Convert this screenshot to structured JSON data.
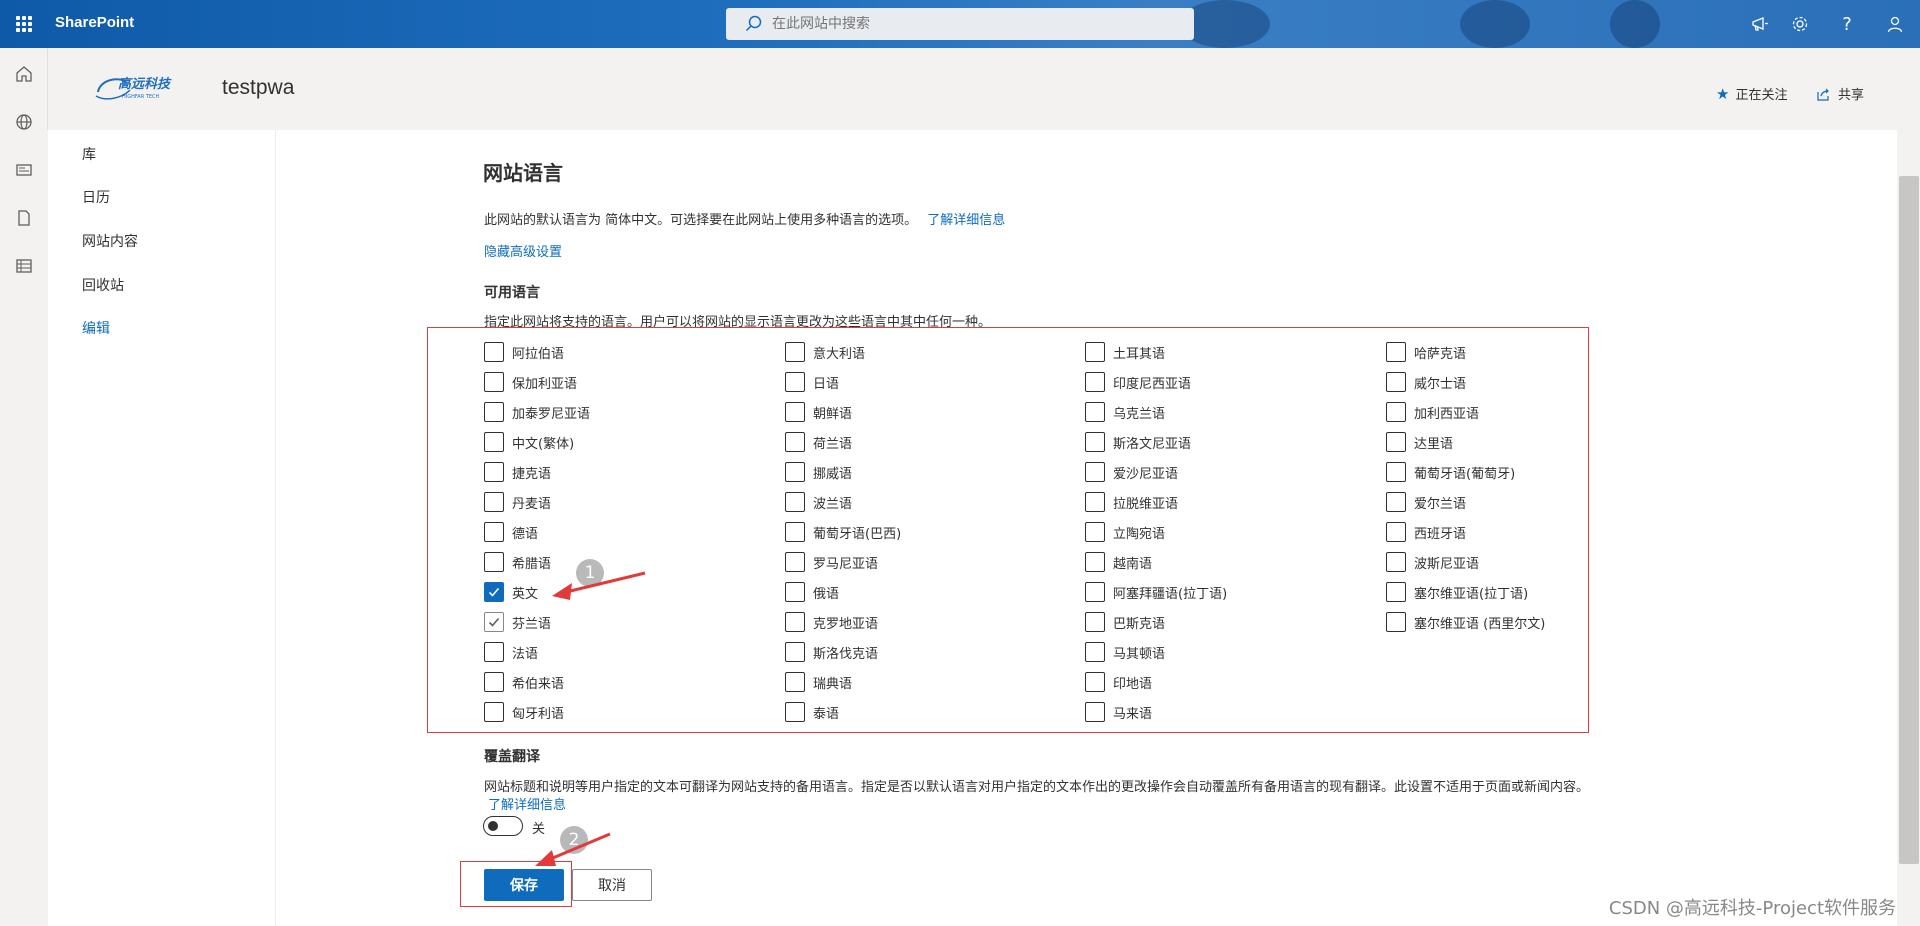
{
  "suite": {
    "app_name": "SharePoint",
    "search_placeholder": "在此网站中搜索"
  },
  "site": {
    "logo_text": "高远科技",
    "logo_subtext": "HIGHFAR TECH",
    "title": "testpwa",
    "follow_label": "正在关注",
    "share_label": "共享"
  },
  "nav": {
    "items": [
      "库",
      "日历",
      "网站内容",
      "回收站"
    ],
    "edit_label": "编辑"
  },
  "main": {
    "page_title": "网站语言",
    "default_lang_text": "此网站的默认语言为 简体中文。可选择要在此网站上使用多种语言的选项。",
    "learn_more": "了解详细信息",
    "hide_advanced": "隐藏高级设置",
    "available_title": "可用语言",
    "available_desc": "指定此网站将支持的语言。用户可以将网站的显示语言更改为这些语言中其中任何一种。",
    "languages": [
      [
        {
          "label": "阿拉伯语",
          "state": "unchecked"
        },
        {
          "label": "保加利亚语",
          "state": "unchecked"
        },
        {
          "label": "加泰罗尼亚语",
          "state": "unchecked"
        },
        {
          "label": "中文(繁体)",
          "state": "unchecked"
        },
        {
          "label": "捷克语",
          "state": "unchecked"
        },
        {
          "label": "丹麦语",
          "state": "unchecked"
        },
        {
          "label": "德语",
          "state": "unchecked"
        },
        {
          "label": "希腊语",
          "state": "unchecked"
        },
        {
          "label": "英文",
          "state": "checked"
        },
        {
          "label": "芬兰语",
          "state": "checked-disabled"
        },
        {
          "label": "法语",
          "state": "unchecked"
        },
        {
          "label": "希伯来语",
          "state": "unchecked"
        },
        {
          "label": "匈牙利语",
          "state": "unchecked"
        }
      ],
      [
        {
          "label": "意大利语",
          "state": "unchecked"
        },
        {
          "label": "日语",
          "state": "unchecked"
        },
        {
          "label": "朝鲜语",
          "state": "unchecked"
        },
        {
          "label": "荷兰语",
          "state": "unchecked"
        },
        {
          "label": "挪威语",
          "state": "unchecked"
        },
        {
          "label": "波兰语",
          "state": "unchecked"
        },
        {
          "label": "葡萄牙语(巴西)",
          "state": "unchecked"
        },
        {
          "label": "罗马尼亚语",
          "state": "unchecked"
        },
        {
          "label": "俄语",
          "state": "unchecked"
        },
        {
          "label": "克罗地亚语",
          "state": "unchecked"
        },
        {
          "label": "斯洛伐克语",
          "state": "unchecked"
        },
        {
          "label": "瑞典语",
          "state": "unchecked"
        },
        {
          "label": "泰语",
          "state": "unchecked"
        }
      ],
      [
        {
          "label": "土耳其语",
          "state": "unchecked"
        },
        {
          "label": "印度尼西亚语",
          "state": "unchecked"
        },
        {
          "label": "乌克兰语",
          "state": "unchecked"
        },
        {
          "label": "斯洛文尼亚语",
          "state": "unchecked"
        },
        {
          "label": "爱沙尼亚语",
          "state": "unchecked"
        },
        {
          "label": "拉脱维亚语",
          "state": "unchecked"
        },
        {
          "label": "立陶宛语",
          "state": "unchecked"
        },
        {
          "label": "越南语",
          "state": "unchecked"
        },
        {
          "label": "阿塞拜疆语(拉丁语)",
          "state": "unchecked"
        },
        {
          "label": "巴斯克语",
          "state": "unchecked"
        },
        {
          "label": "马其顿语",
          "state": "unchecked"
        },
        {
          "label": "印地语",
          "state": "unchecked"
        },
        {
          "label": "马来语",
          "state": "unchecked"
        }
      ],
      [
        {
          "label": "哈萨克语",
          "state": "unchecked"
        },
        {
          "label": "威尔士语",
          "state": "unchecked"
        },
        {
          "label": "加利西亚语",
          "state": "unchecked"
        },
        {
          "label": "达里语",
          "state": "unchecked"
        },
        {
          "label": "葡萄牙语(葡萄牙)",
          "state": "unchecked"
        },
        {
          "label": "爱尔兰语",
          "state": "unchecked"
        },
        {
          "label": "西班牙语",
          "state": "unchecked"
        },
        {
          "label": "波斯尼亚语",
          "state": "unchecked"
        },
        {
          "label": "塞尔维亚语(拉丁语)",
          "state": "unchecked"
        },
        {
          "label": "塞尔维亚语 (西里尔文)",
          "state": "unchecked"
        }
      ]
    ],
    "override_title": "覆盖翻译",
    "override_desc": "网站标题和说明等用户指定的文本可翻译为网站支持的备用语言。指定是否以默认语言对用户指定的文本作出的更改操作会自动覆盖所有备用语言的现有翻译。此设置不适用于页面或新闻内容。",
    "override_learn_more": "了解详细信息",
    "toggle_label": "关",
    "toggle_on": false,
    "save_label": "保存",
    "cancel_label": "取消"
  },
  "annotations": {
    "badge1": "1",
    "badge2": "2",
    "watermark": "CSDN @高远科技-Project软件服务"
  },
  "colors": {
    "accent": "#0f6cbd",
    "highlight_red": "#e03a3a"
  }
}
